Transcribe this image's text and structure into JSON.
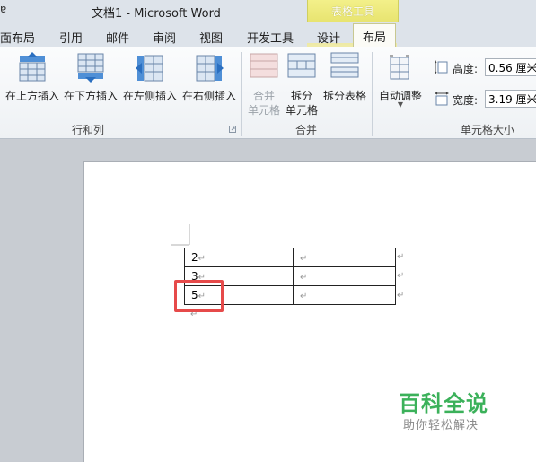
{
  "titlebar": {
    "quick_access": "ɐ",
    "title": "文档1 - Microsoft Word"
  },
  "context_header": "表格工具",
  "tabs": [
    "面布局",
    "引用",
    "邮件",
    "审阅",
    "视图",
    "开发工具",
    "设计",
    "布局"
  ],
  "ribbon": {
    "rows_cols": {
      "insert_above": "在上方插入",
      "insert_below": "在下方插入",
      "insert_left": "在左侧插入",
      "insert_right": "在右侧插入",
      "group_label": "行和列"
    },
    "merge": {
      "merge_cells_1": "合并",
      "merge_cells_2": "单元格",
      "split_cells_1": "拆分",
      "split_cells_2": "单元格",
      "split_table": "拆分表格",
      "group_label": "合并"
    },
    "cell_size": {
      "autofit": "自动调整",
      "height_label": "高度:",
      "height_value": "0.56 厘米",
      "width_label": "宽度:",
      "width_value": "3.19 厘米",
      "group_label": "单元格大小"
    }
  },
  "document": {
    "table_rows": [
      {
        "c1": "2",
        "c2": ""
      },
      {
        "c1": "3",
        "c2": ""
      },
      {
        "c1": "5",
        "c2": ""
      }
    ],
    "paragraph_mark": "↵"
  },
  "watermark": {
    "title": "百科全说",
    "subtitle": "助你轻松解决"
  },
  "colors": {
    "highlight": "#e64a4a",
    "watermark": "#3bb15a",
    "context_tab": "#f3f08a"
  }
}
